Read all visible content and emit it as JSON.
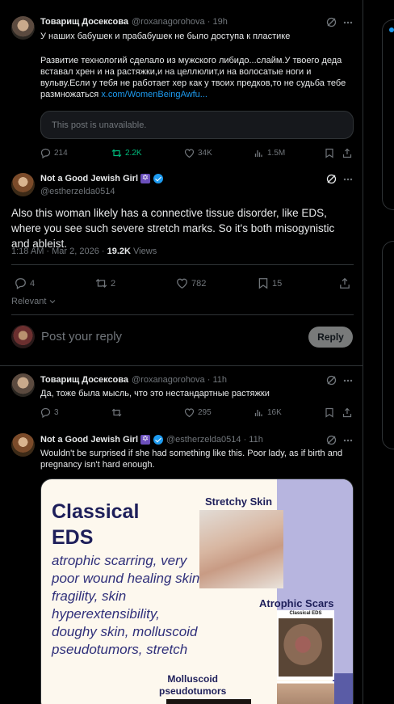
{
  "tweet1": {
    "name": "Товарищ Досексова",
    "handle": "@roxanagorohova",
    "time": "· 19h",
    "line1": "У наших бабушек и прабабушек не было доступа к пластике",
    "body": "Развитие технологий сделало из мужского либидо...слайм.У твоего деда вставал хрен и на растяжки,и на целлюлит,и на волосатые ноги и вульву.Если у тебя не работает хер как у твоих предков,то не судьба тебе размножаться",
    "link": "x.com/WomenBeingAwfu...",
    "unavailable": "This post is unavailable.",
    "replies": "214",
    "reposts": "2.2K",
    "likes": "34K",
    "views": "1.5M"
  },
  "main_tweet": {
    "name": "Not a Good Jewish Girl",
    "badge": "✡",
    "handle": "@estherzelda0514",
    "body": "Also this woman likely has a connective tissue disorder, like EDS, where you see such severe stretch marks. So it's both misogynistic and ableist.",
    "timestamp": "1:18 AM · Mar 2, 2026 ·",
    "views_count": "19.2K",
    "views_label": "Views",
    "replies": "4",
    "reposts": "2",
    "likes": "782",
    "bookmarks": "15",
    "sort_label": "Relevant"
  },
  "composer": {
    "placeholder": "Post your reply",
    "reply_button": "Reply"
  },
  "reply1": {
    "name": "Товарищ Досексова",
    "handle": "@roxanagorohova · 11h",
    "body": "Да, тоже была мысль, что это нестандартные растяжки",
    "replies": "3",
    "likes": "295",
    "views": "16K"
  },
  "reply2": {
    "name": "Not a Good Jewish Girl",
    "badge": "✡",
    "handle": "@estherzelda0514 · 11h",
    "body": "Wouldn't be surprised if she had something like this. Poor lady, as if birth and pregnancy isn't hard enough.",
    "image": {
      "title_line1": "Classical",
      "title_line2": "EDS",
      "list": "atrophic scarring, very poor wound healing skin fragility, skin hyperextensibility, doughy skin, molluscoid pseudotumors, stretch",
      "stretchy": "Stretchy Skin",
      "atrophic": "Atrophic Scars",
      "classical_small": "Classical EDS",
      "molluscoid1": "Molluscoid",
      "molluscoid2": "pseudotumors"
    }
  },
  "colors": {
    "background": "#000000",
    "text": "#e7e9ea",
    "muted": "#71767b",
    "link": "#1d9bf0",
    "repost_active": "#00ba7c",
    "border": "#2f3336"
  }
}
